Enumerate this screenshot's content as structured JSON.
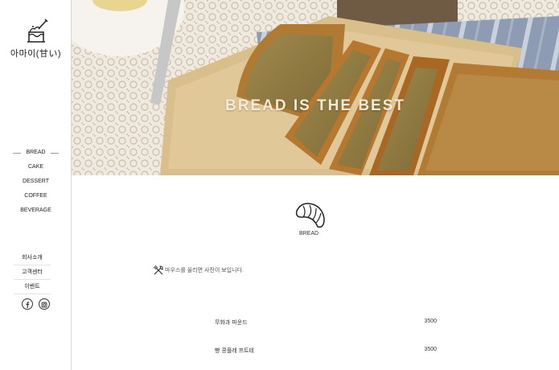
{
  "brand": {
    "logo_text": "아마이(甘い)"
  },
  "sidebar": {
    "nav": [
      {
        "label": "BREAD",
        "active": true
      },
      {
        "label": "CAKE",
        "active": false
      },
      {
        "label": "DESSERT",
        "active": false
      },
      {
        "label": "COFFEE",
        "active": false
      },
      {
        "label": "BEVERAGE",
        "active": false
      }
    ],
    "subnav": [
      {
        "label": "회사소개"
      },
      {
        "label": "고객센터"
      },
      {
        "label": "이벤트"
      }
    ],
    "social": [
      "facebook-icon",
      "instagram-icon"
    ]
  },
  "hero": {
    "title": "BREAD IS THE BEST"
  },
  "main": {
    "category_label": "BREAD",
    "hint": "마우스를 올리면 사진이 보입니다.",
    "menu": [
      {
        "name": "무화과 파운드",
        "price": "3500"
      },
      {
        "name": "빵 콩플레 프트테",
        "price": "3500"
      }
    ]
  },
  "colors": {
    "accent": "#f3ead8",
    "text": "#222222",
    "border": "#d8d8d8"
  }
}
